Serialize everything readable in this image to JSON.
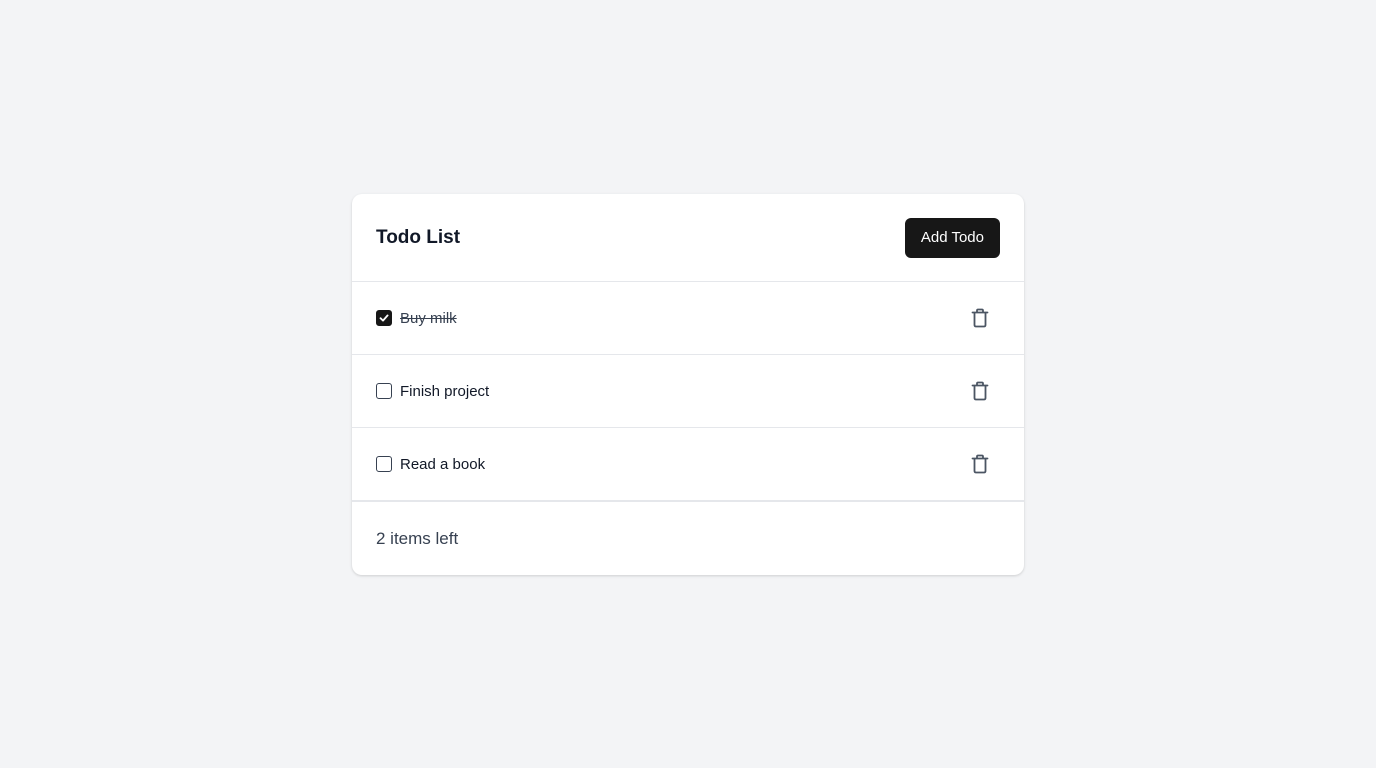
{
  "header": {
    "title": "Todo List",
    "add_button_label": "Add Todo"
  },
  "todos": [
    {
      "text": "Buy milk",
      "completed": true
    },
    {
      "text": "Finish project",
      "completed": false
    },
    {
      "text": "Read a book",
      "completed": false
    }
  ],
  "footer": {
    "items_left": "2 items left"
  },
  "icons": {
    "check": "check-icon",
    "delete": "trash-icon"
  },
  "colors": {
    "background": "#f3f4f6",
    "card": "#ffffff",
    "primary_button": "#171717",
    "icon": "#4b5563"
  }
}
